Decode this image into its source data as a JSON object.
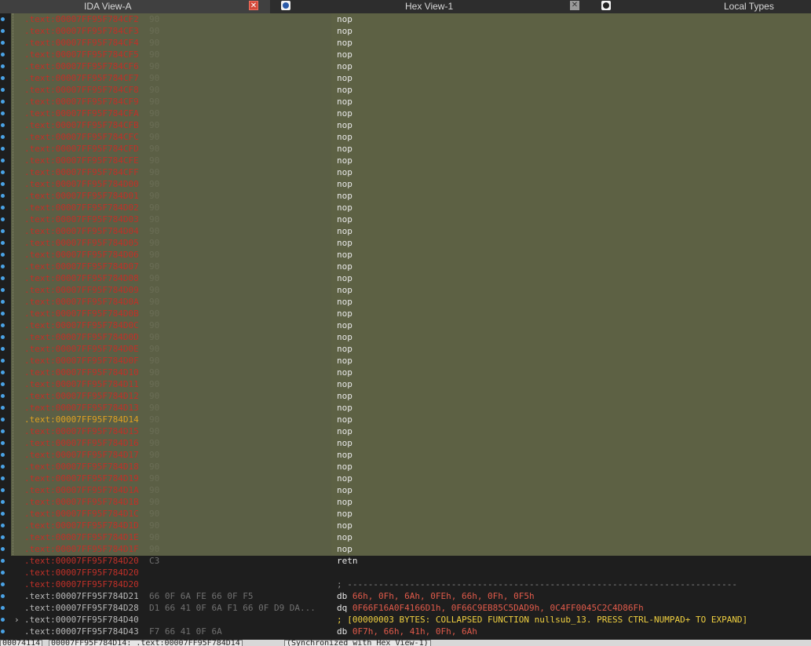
{
  "tabs": [
    {
      "label": "IDA View-A"
    },
    {
      "label": "Hex View-1"
    },
    {
      "label": "Local Types"
    }
  ],
  "icons": {
    "close": "close-icon",
    "hex": "hex-view-icon",
    "types": "local-types-icon"
  },
  "colors": {
    "address": "#c03028",
    "address_current": "#e0a020",
    "selection": "#5b5f45",
    "instruction": "#e8e8e8",
    "number": "#e05a4a",
    "comment": "#f0d040",
    "gutter_dot": "#4aa3e6"
  },
  "lines": [
    {
      "addr": ".text:00007FF95F784CF2",
      "bytes": "90",
      "instr": "nop"
    },
    {
      "addr": ".text:00007FF95F784CF3",
      "bytes": "90",
      "instr": "nop"
    },
    {
      "addr": ".text:00007FF95F784CF4",
      "bytes": "90",
      "instr": "nop"
    },
    {
      "addr": ".text:00007FF95F784CF5",
      "bytes": "90",
      "instr": "nop"
    },
    {
      "addr": ".text:00007FF95F784CF6",
      "bytes": "90",
      "instr": "nop"
    },
    {
      "addr": ".text:00007FF95F784CF7",
      "bytes": "90",
      "instr": "nop"
    },
    {
      "addr": ".text:00007FF95F784CF8",
      "bytes": "90",
      "instr": "nop"
    },
    {
      "addr": ".text:00007FF95F784CF9",
      "bytes": "90",
      "instr": "nop"
    },
    {
      "addr": ".text:00007FF95F784CFA",
      "bytes": "90",
      "instr": "nop"
    },
    {
      "addr": ".text:00007FF95F784CFB",
      "bytes": "90",
      "instr": "nop"
    },
    {
      "addr": ".text:00007FF95F784CFC",
      "bytes": "90",
      "instr": "nop"
    },
    {
      "addr": ".text:00007FF95F784CFD",
      "bytes": "90",
      "instr": "nop"
    },
    {
      "addr": ".text:00007FF95F784CFE",
      "bytes": "90",
      "instr": "nop"
    },
    {
      "addr": ".text:00007FF95F784CFF",
      "bytes": "90",
      "instr": "nop"
    },
    {
      "addr": ".text:00007FF95F784D00",
      "bytes": "90",
      "instr": "nop"
    },
    {
      "addr": ".text:00007FF95F784D01",
      "bytes": "90",
      "instr": "nop"
    },
    {
      "addr": ".text:00007FF95F784D02",
      "bytes": "90",
      "instr": "nop"
    },
    {
      "addr": ".text:00007FF95F784D03",
      "bytes": "90",
      "instr": "nop"
    },
    {
      "addr": ".text:00007FF95F784D04",
      "bytes": "90",
      "instr": "nop"
    },
    {
      "addr": ".text:00007FF95F784D05",
      "bytes": "90",
      "instr": "nop"
    },
    {
      "addr": ".text:00007FF95F784D06",
      "bytes": "90",
      "instr": "nop"
    },
    {
      "addr": ".text:00007FF95F784D07",
      "bytes": "90",
      "instr": "nop"
    },
    {
      "addr": ".text:00007FF95F784D08",
      "bytes": "90",
      "instr": "nop"
    },
    {
      "addr": ".text:00007FF95F784D09",
      "bytes": "90",
      "instr": "nop"
    },
    {
      "addr": ".text:00007FF95F784D0A",
      "bytes": "90",
      "instr": "nop"
    },
    {
      "addr": ".text:00007FF95F784D0B",
      "bytes": "90",
      "instr": "nop"
    },
    {
      "addr": ".text:00007FF95F784D0C",
      "bytes": "90",
      "instr": "nop"
    },
    {
      "addr": ".text:00007FF95F784D0D",
      "bytes": "90",
      "instr": "nop"
    },
    {
      "addr": ".text:00007FF95F784D0E",
      "bytes": "90",
      "instr": "nop"
    },
    {
      "addr": ".text:00007FF95F784D0F",
      "bytes": "90",
      "instr": "nop"
    },
    {
      "addr": ".text:00007FF95F784D10",
      "bytes": "90",
      "instr": "nop"
    },
    {
      "addr": ".text:00007FF95F784D11",
      "bytes": "90",
      "instr": "nop"
    },
    {
      "addr": ".text:00007FF95F784D12",
      "bytes": "90",
      "instr": "nop"
    },
    {
      "addr": ".text:00007FF95F784D13",
      "bytes": "90",
      "instr": "nop"
    },
    {
      "addr": ".text:00007FF95F784D14",
      "bytes": "90",
      "instr": "nop",
      "current": true
    },
    {
      "addr": ".text:00007FF95F784D15",
      "bytes": "90",
      "instr": "nop"
    },
    {
      "addr": ".text:00007FF95F784D16",
      "bytes": "90",
      "instr": "nop"
    },
    {
      "addr": ".text:00007FF95F784D17",
      "bytes": "90",
      "instr": "nop"
    },
    {
      "addr": ".text:00007FF95F784D18",
      "bytes": "90",
      "instr": "nop"
    },
    {
      "addr": ".text:00007FF95F784D19",
      "bytes": "90",
      "instr": "nop"
    },
    {
      "addr": ".text:00007FF95F784D1A",
      "bytes": "90",
      "instr": "nop"
    },
    {
      "addr": ".text:00007FF95F784D1B",
      "bytes": "90",
      "instr": "nop"
    },
    {
      "addr": ".text:00007FF95F784D1C",
      "bytes": "90",
      "instr": "nop"
    },
    {
      "addr": ".text:00007FF95F784D1D",
      "bytes": "90",
      "instr": "nop"
    },
    {
      "addr": ".text:00007FF95F784D1E",
      "bytes": "90",
      "instr": "nop"
    },
    {
      "addr": ".text:00007FF95F784D1F",
      "bytes": "90",
      "instr": "nop"
    }
  ],
  "tail_lines": [
    {
      "addr": ".text:00007FF95F784D20",
      "bytes": "C3",
      "instr": "retn",
      "kind": "plain"
    },
    {
      "addr": ".text:00007FF95F784D20",
      "bytes": "",
      "instr": "",
      "kind": "plain"
    },
    {
      "addr": ".text:00007FF95F784D20",
      "bytes": "",
      "instr": "; ---------------------------------------------------------------------------",
      "kind": "sep"
    },
    {
      "addr": ".text:00007FF95F784D21",
      "bytes": "66 0F 6A FE 66 0F F5",
      "instr_prefix": "db ",
      "instr_nums": "66h, 0Fh, 6Ah, 0FEh, 66h, 0Fh, 0F5h",
      "kind": "data",
      "gray": true
    },
    {
      "addr": ".text:00007FF95F784D28",
      "bytes": "D1 66 41 0F 6A F1 66 0F D9 DA...",
      "instr_prefix": "dq ",
      "instr_nums": "0F66F16A0F4166D1h, 0F66C9EB85C5DAD9h, 0C4FF0045C2C4D86Fh",
      "kind": "data",
      "gray": true
    },
    {
      "addr": ".text:00007FF95F784D40",
      "bytes": "",
      "instr": "; [00000003 BYTES: COLLAPSED FUNCTION nullsub_13. PRESS CTRL-NUMPAD+ TO EXPAND]",
      "kind": "comment",
      "gray": true,
      "arrow": "›"
    },
    {
      "addr": ".text:00007FF95F784D43",
      "bytes": "F7 66 41 0F 6A",
      "instr_prefix": "db ",
      "instr_nums": "0F7h, 66h, 41h, 0Fh, 6Ah",
      "kind": "data",
      "gray": true
    }
  ],
  "status": {
    "offset": "00074114",
    "location": "00007FF95F784D14: .text:00007FF95F784D14",
    "sync": "(Synchronized with Hex View-1)"
  }
}
